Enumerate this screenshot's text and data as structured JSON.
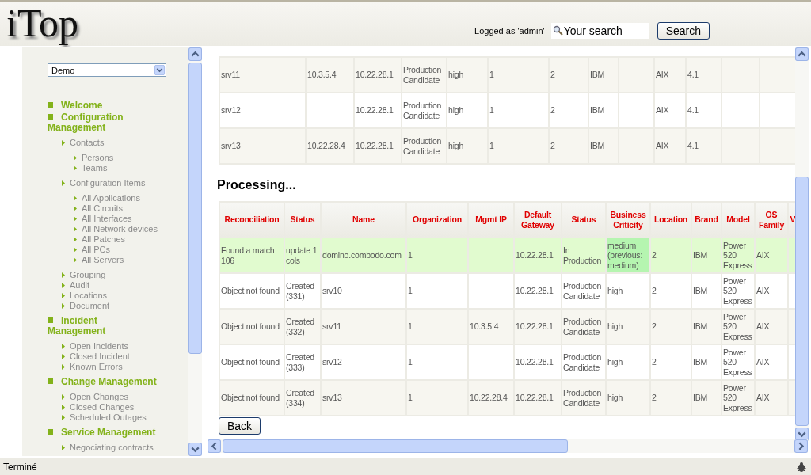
{
  "header": {
    "logo": "iTop",
    "logged_as": "Logged as 'admin'",
    "search": {
      "placeholder": "Your search"
    },
    "search_button": "Search"
  },
  "sidebar": {
    "organization_select": "Demo",
    "menu": [
      {
        "label": "Welcome"
      },
      {
        "label": "Configuration Management",
        "children": [
          {
            "label": "Contacts",
            "children": [
              {
                "label": "Persons"
              },
              {
                "label": "Teams"
              }
            ]
          },
          {
            "label": "Configuration Items",
            "children": [
              {
                "label": "All Applications"
              },
              {
                "label": "All Circuits"
              },
              {
                "label": "All Interfaces"
              },
              {
                "label": "All Network devices"
              },
              {
                "label": "All Patches"
              },
              {
                "label": "All PCs"
              },
              {
                "label": "All Servers"
              }
            ]
          },
          {
            "label": "Grouping"
          },
          {
            "label": "Audit"
          },
          {
            "label": "Locations"
          },
          {
            "label": "Document"
          }
        ]
      },
      {
        "label": "Incident Management",
        "children": [
          {
            "label": "Open Incidents"
          },
          {
            "label": "Closed Incident"
          },
          {
            "label": "Known Errors"
          }
        ]
      },
      {
        "label": "Change Management",
        "children": [
          {
            "label": "Open Changes"
          },
          {
            "label": "Closed Changes"
          },
          {
            "label": "Scheduled Outages"
          }
        ]
      },
      {
        "label": "Service Management",
        "children": [
          {
            "label": "Negociating contracts"
          }
        ]
      }
    ]
  },
  "preview_table": {
    "rows": [
      [
        "srv11",
        "10.3.5.4",
        "10.22.28.1",
        "Production Candidate",
        "high",
        "1",
        "2",
        "IBM",
        "",
        "AIX",
        "4.1",
        "",
        ""
      ],
      [
        "srv12",
        "",
        "10.22.28.1",
        "Production Candidate",
        "high",
        "1",
        "2",
        "IBM",
        "",
        "AIX",
        "4.1",
        "",
        ""
      ],
      [
        "srv13",
        "10.22.28.4",
        "10.22.28.1",
        "Production Candidate",
        "high",
        "1",
        "2",
        "IBM",
        "",
        "AIX",
        "4.1",
        "",
        ""
      ]
    ]
  },
  "processing": {
    "title": "Processing...",
    "columns": [
      "Reconciliation",
      "Status",
      "Name",
      "Organization",
      "Mgmt IP",
      "Default Gateway",
      "Status",
      "Business Criticity",
      "Location",
      "Brand",
      "Model",
      "OS Family",
      "V"
    ],
    "rows": [
      {
        "kind": "update",
        "cells": [
          "Found a match 106",
          "update 1 cols",
          "domino.combodo.com",
          "1",
          "",
          "10.22.28.1",
          "In Production",
          {
            "text": "medium (previous: medium)",
            "changed": true
          },
          "2",
          "IBM",
          "Power 520 Express",
          "AIX",
          ""
        ]
      },
      {
        "kind": "create",
        "cells": [
          "Object not found",
          "Created (331)",
          "srv10",
          "1",
          "",
          "10.22.28.1",
          "Production Candidate",
          "high",
          "2",
          "IBM",
          "Power 520 Express",
          "AIX",
          ""
        ]
      },
      {
        "kind": "create",
        "cells": [
          "Object not found",
          "Created (332)",
          "srv11",
          "1",
          "10.3.5.4",
          "10.22.28.1",
          "Production Candidate",
          "high",
          "2",
          "IBM",
          "Power 520 Express",
          "AIX",
          ""
        ]
      },
      {
        "kind": "create",
        "cells": [
          "Object not found",
          "Created (333)",
          "srv12",
          "1",
          "",
          "10.22.28.1",
          "Production Candidate",
          "high",
          "2",
          "IBM",
          "Power 520 Express",
          "AIX",
          ""
        ]
      },
      {
        "kind": "create",
        "cells": [
          "Object not found",
          "Created (334)",
          "srv13",
          "1",
          "10.22.28.4",
          "10.22.28.1",
          "Production Candidate",
          "high",
          "2",
          "IBM",
          "Power 520 Express",
          "AIX",
          ""
        ]
      }
    ],
    "back_button": "Back"
  },
  "status_bar": {
    "text": "Terminé"
  }
}
